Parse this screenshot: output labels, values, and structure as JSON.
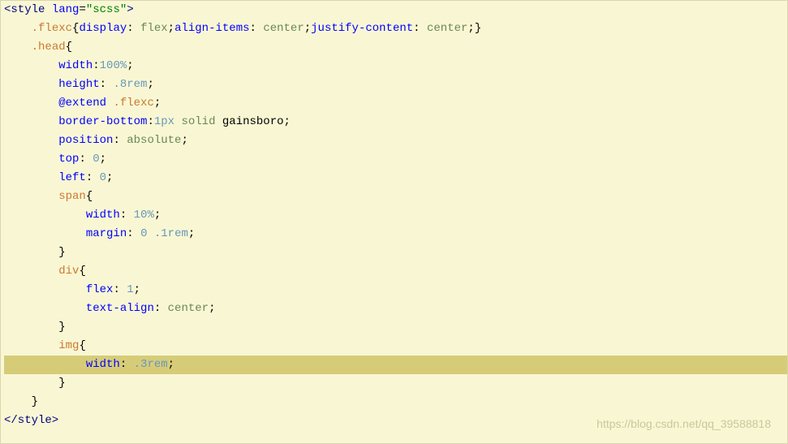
{
  "lines": [
    {
      "indent": 0,
      "type": "open-tag",
      "tag": "style",
      "attr_name": "lang",
      "attr_val": "\"scss\""
    },
    {
      "indent": 1,
      "type": "rule",
      "selector": ".flexc",
      "decls_inline": [
        {
          "prop": "display",
          "val": "flex",
          "val_type": "keyword"
        },
        {
          "prop": "align-items",
          "val": "center",
          "val_type": "keyword"
        },
        {
          "prop": "justify-content",
          "val": "center",
          "val_type": "keyword"
        }
      ],
      "close_same_line": true
    },
    {
      "indent": 1,
      "type": "open-selector",
      "selector": ".head"
    },
    {
      "indent": 2,
      "type": "decl",
      "prop": "width",
      "sep": ":",
      "val": "100%",
      "val_type": "num"
    },
    {
      "indent": 2,
      "type": "decl",
      "prop": "height",
      "sep": ": ",
      "val": ".8rem",
      "val_type": "num"
    },
    {
      "indent": 2,
      "type": "extend",
      "keyword": "@extend",
      "target": ".flexc"
    },
    {
      "indent": 2,
      "type": "decl3",
      "prop": "border-bottom",
      "sep": ":",
      "v1": "1px",
      "v2": "solid",
      "v3": "gainsboro"
    },
    {
      "indent": 2,
      "type": "decl",
      "prop": "position",
      "sep": ": ",
      "val": "absolute",
      "val_type": "keyword"
    },
    {
      "indent": 2,
      "type": "decl",
      "prop": "top",
      "sep": ": ",
      "val": "0",
      "val_type": "num"
    },
    {
      "indent": 2,
      "type": "decl",
      "prop": "left",
      "sep": ": ",
      "val": "0",
      "val_type": "num"
    },
    {
      "indent": 2,
      "type": "open-selector",
      "selector": "span"
    },
    {
      "indent": 3,
      "type": "decl",
      "prop": "width",
      "sep": ": ",
      "val": "10%",
      "val_type": "num"
    },
    {
      "indent": 3,
      "type": "decl2",
      "prop": "margin",
      "sep": ": ",
      "v1": "0",
      "v2": ".1rem"
    },
    {
      "indent": 2,
      "type": "close"
    },
    {
      "indent": 2,
      "type": "open-selector",
      "selector": "div"
    },
    {
      "indent": 3,
      "type": "decl",
      "prop": "flex",
      "sep": ": ",
      "val": "1",
      "val_type": "num"
    },
    {
      "indent": 3,
      "type": "decl",
      "prop": "text-align",
      "sep": ": ",
      "val": "center",
      "val_type": "keyword"
    },
    {
      "indent": 2,
      "type": "close"
    },
    {
      "indent": 2,
      "type": "open-selector",
      "selector": "img"
    },
    {
      "indent": 3,
      "type": "decl",
      "prop": "width",
      "sep": ": ",
      "val": ".3rem",
      "val_type": "num",
      "highlighted": true
    },
    {
      "indent": 2,
      "type": "close"
    },
    {
      "indent": 1,
      "type": "close"
    },
    {
      "indent": 0,
      "type": "close-tag",
      "tag": "style"
    }
  ],
  "watermark": "https://blog.csdn.net/qq_39588818"
}
